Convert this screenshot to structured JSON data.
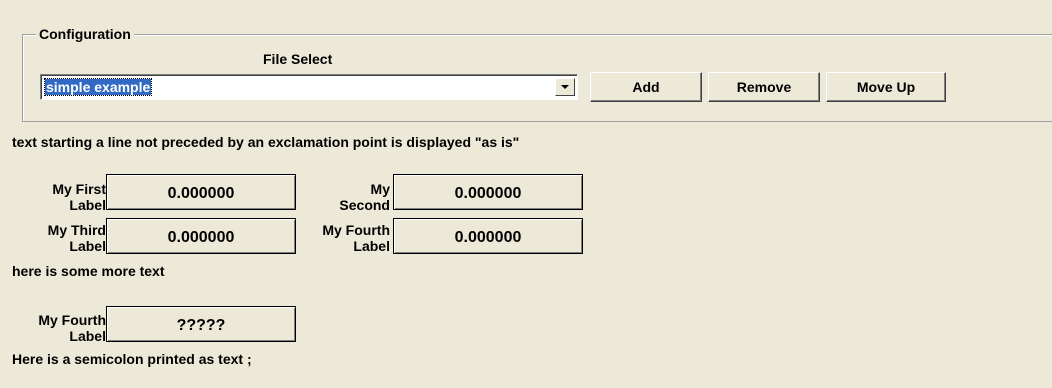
{
  "configuration": {
    "group_title": "Configuration",
    "file_select_label": "File Select",
    "selected_file": "simple example",
    "add_label": "Add",
    "remove_label": "Remove",
    "move_up_label": "Move Up"
  },
  "text_lines": {
    "intro": "text starting a line not preceded by an exclamation point is displayed \"as is\"",
    "more": "here is some more text",
    "semicolon": "Here is a semicolon printed as text ;"
  },
  "fields": [
    {
      "label_line1": "My First",
      "label_line2": "Label",
      "value": "0.000000"
    },
    {
      "label_line1": "My",
      "label_line2": "Second",
      "value": "0.000000"
    },
    {
      "label_line1": "My Third",
      "label_line2": "Label",
      "value": "0.000000"
    },
    {
      "label_line1": "My Fourth",
      "label_line2": "Label",
      "value": "0.000000"
    },
    {
      "label_line1": "My Fourth",
      "label_line2": "Label",
      "value": "?????"
    }
  ],
  "icons": {
    "combo_arrow": "chevron-down-icon"
  }
}
